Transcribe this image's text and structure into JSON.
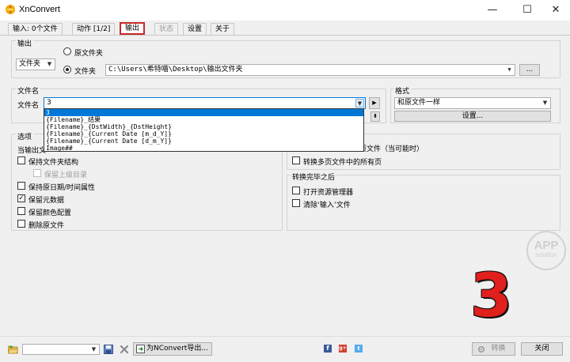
{
  "window": {
    "title": "XnConvert",
    "minimize": "—",
    "maximize": "☐",
    "close": "✕"
  },
  "tabs": [
    {
      "label": "输入: 0个文件"
    },
    {
      "label": "动作 [1/2]"
    },
    {
      "label": "输出"
    },
    {
      "label": "状态"
    },
    {
      "label": "设置"
    },
    {
      "label": "关于"
    }
  ],
  "output": {
    "section_label": "输出",
    "type_value": "文件夹",
    "radio_original": "原文件夹",
    "radio_folder": "文件夹",
    "folder_path": "C:\\Users\\希特喵\\Desktop\\输出文件夹",
    "browse_label": "..."
  },
  "filename": {
    "section_label": "文件名",
    "field_label": "文件名",
    "value": "3",
    "dropdown_options": [
      "3",
      "{Filename}_结果",
      "{Filename}_{DstWidth}_{DstHeight}",
      "{Filename}_{Current Date [m_d_Y]}",
      "{Filename}_{Current Date [d_m_Y]}",
      "Image##"
    ],
    "play_icon": "▶",
    "spin_icon": "⬍"
  },
  "format": {
    "section_label": "格式",
    "value": "和原文件一样",
    "settings_label": "设置..."
  },
  "options": {
    "section_label": "选项",
    "partial_label": "当输出文",
    "items": [
      {
        "label": "保持文件夹结构",
        "checked": false,
        "disabled": false,
        "indent": false
      },
      {
        "label": "保留上级目录",
        "checked": false,
        "disabled": true,
        "indent": true
      },
      {
        "label": "保持原日期/时间属性",
        "checked": false,
        "disabled": false,
        "indent": false
      },
      {
        "label": "保留元数据",
        "checked": true,
        "disabled": false,
        "indent": false
      },
      {
        "label": "保留颜色配置",
        "checked": false,
        "disabled": false,
        "indent": false
      },
      {
        "label": "删除原文件",
        "checked": false,
        "disabled": false,
        "indent": false
      }
    ]
  },
  "multipage": {
    "partial_label": "页文件（当可能时）",
    "convert_all_pages": "转换多页文件中的所有页"
  },
  "after_convert": {
    "section_label": "转换完毕之后",
    "items": [
      {
        "label": "打开资源管理器"
      },
      {
        "label": "清除‘输入’文件"
      }
    ]
  },
  "bottom": {
    "folder_icon": "folder-open-icon",
    "save_icon": "save-icon",
    "delete_icon": "delete-icon",
    "export_label": "为NConvert导出...",
    "convert_label": "转换",
    "close_label": "关闭",
    "social": [
      "f",
      "g+",
      "t"
    ]
  },
  "overlay": {
    "big_number": "3",
    "watermark_top": "APP",
    "watermark_bottom": "solution"
  },
  "colors": {
    "accent_red": "#c82828",
    "selection_blue": "#0078d7",
    "big_number_red": "#e0201c"
  }
}
